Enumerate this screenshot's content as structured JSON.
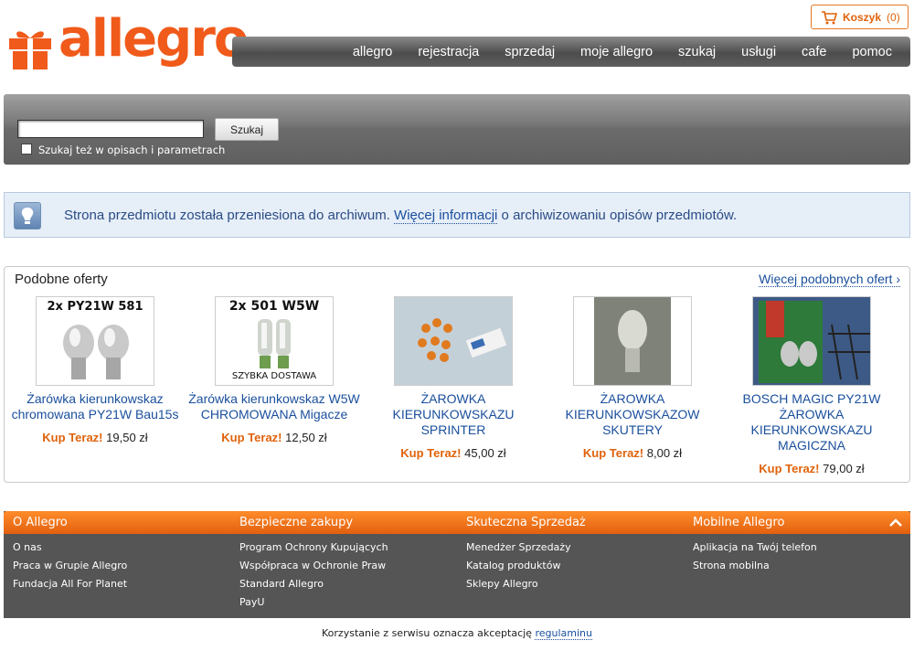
{
  "header": {
    "logo_text": "allegro",
    "cart_label": "Koszyk",
    "cart_count": "(0)",
    "nav": [
      "allegro",
      "rejestracja",
      "sprzedaj",
      "moje allegro",
      "szukaj",
      "usługi",
      "cafe",
      "pomoc"
    ]
  },
  "search": {
    "input_value": "",
    "button_label": "Szukaj",
    "checkbox_label": "Szukaj też w opisach i parametrach",
    "checkbox_checked": false
  },
  "info": {
    "text_before": "Strona przedmiotu została przeniesiona do archiwum. ",
    "link_text": "Więcej informacji",
    "text_after": " o archiwizowaniu opisów przedmiotów."
  },
  "similar": {
    "title": "Podobne oferty",
    "more_link": "Więcej podobnych ofert ›",
    "items": [
      {
        "name": "Żarówka kierunkowskaz chromowana PY21W Bau15s",
        "buy_label": "Kup Teraz!",
        "price": "19,50 zł",
        "image_caption": "2x PY21W 581"
      },
      {
        "name": "Żarówka kierunkowskaz W5W CHROMOWANA Migacze",
        "buy_label": "Kup Teraz!",
        "price": "12,50 zł",
        "image_caption": "2x 501 W5W",
        "image_caption2": "SZYBKA DOSTAWA"
      },
      {
        "name": "ŻAROWKA KIERUNKOWSKAZU SPRINTER",
        "buy_label": "Kup Teraz!",
        "price": "45,00 zł"
      },
      {
        "name": "ŻAROWKA KIERUNKOWSKAZOW SKUTERY",
        "buy_label": "Kup Teraz!",
        "price": "8,00 zł"
      },
      {
        "name": "BOSCH MAGIC PY21W ŻAROWKA KIERUNKOWSKAZU MAGICZNA",
        "buy_label": "Kup Teraz!",
        "price": "79,00 zł"
      }
    ]
  },
  "footer": {
    "columns": [
      {
        "title": "O Allegro",
        "links": [
          "O nas",
          "Praca w Grupie Allegro",
          "Fundacja All For Planet"
        ]
      },
      {
        "title": "Bezpieczne zakupy",
        "links": [
          "Program Ochrony Kupujących",
          "Współpraca w Ochronie Praw",
          "Standard Allegro",
          "PayU"
        ]
      },
      {
        "title": "Skuteczna Sprzedaż",
        "links": [
          "Menedżer Sprzedaży",
          "Katalog produktów",
          "Sklepy Allegro"
        ]
      },
      {
        "title": "Mobilne Allegro",
        "links": [
          "Aplikacja na Twój telefon",
          "Strona mobilna"
        ]
      }
    ],
    "legal_text": "Korzystanie z serwisu oznacza akceptację ",
    "legal_link": "regulaminu"
  },
  "colors": {
    "brand": "#f05a1a",
    "link": "#1a4f9c",
    "footer_bg": "#555555"
  }
}
